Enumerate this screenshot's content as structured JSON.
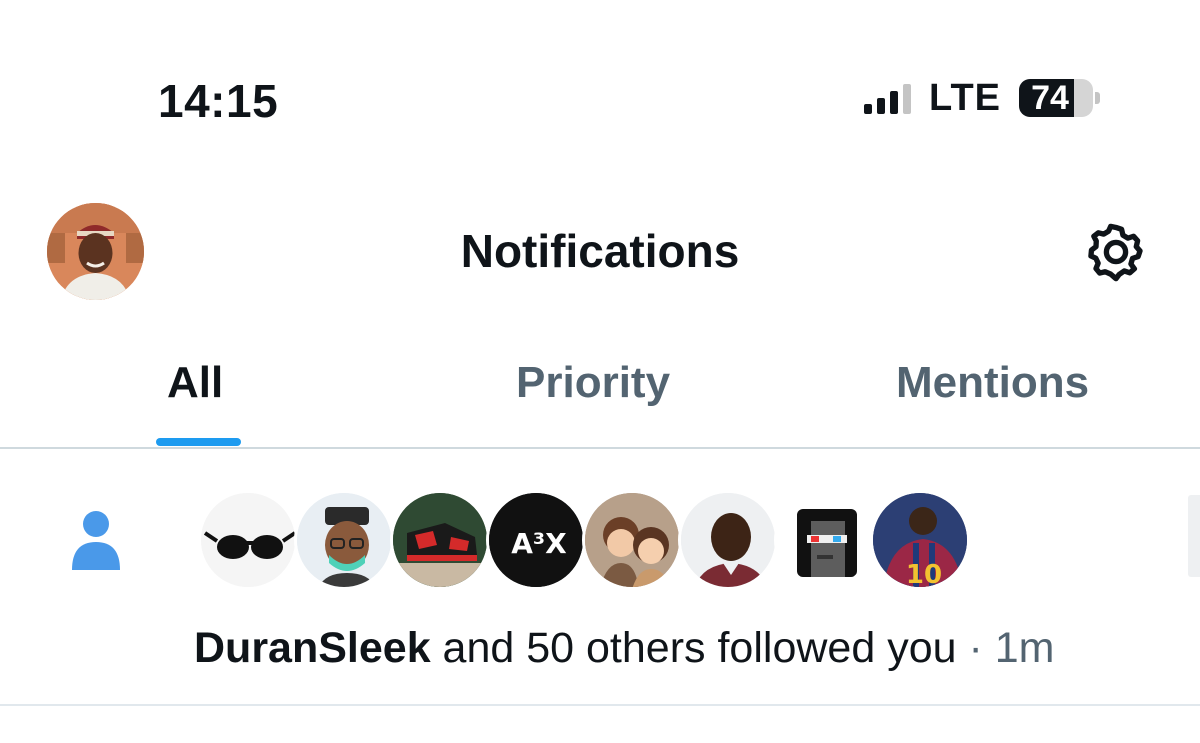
{
  "status_bar": {
    "time": "14:15",
    "network": "LTE",
    "battery": 74
  },
  "header": {
    "title": "Notifications",
    "avatar_icon": "profile-avatar",
    "settings_icon": "gear-icon"
  },
  "tabs": [
    {
      "label": "All",
      "active": true
    },
    {
      "label": "Priority",
      "active": false
    },
    {
      "label": "Mentions",
      "active": false
    }
  ],
  "notification": {
    "icon": "person-icon",
    "icon_color": "#4a99e9",
    "avatar_count": 8,
    "name": "DuranSleek",
    "text": " and 50 others followed you ",
    "dot": "·",
    "time": " 1m",
    "avatar_badge": "A³X"
  },
  "colors": {
    "accent": "#1d9bf0",
    "text_primary": "#0f1419",
    "text_secondary": "#536471"
  }
}
